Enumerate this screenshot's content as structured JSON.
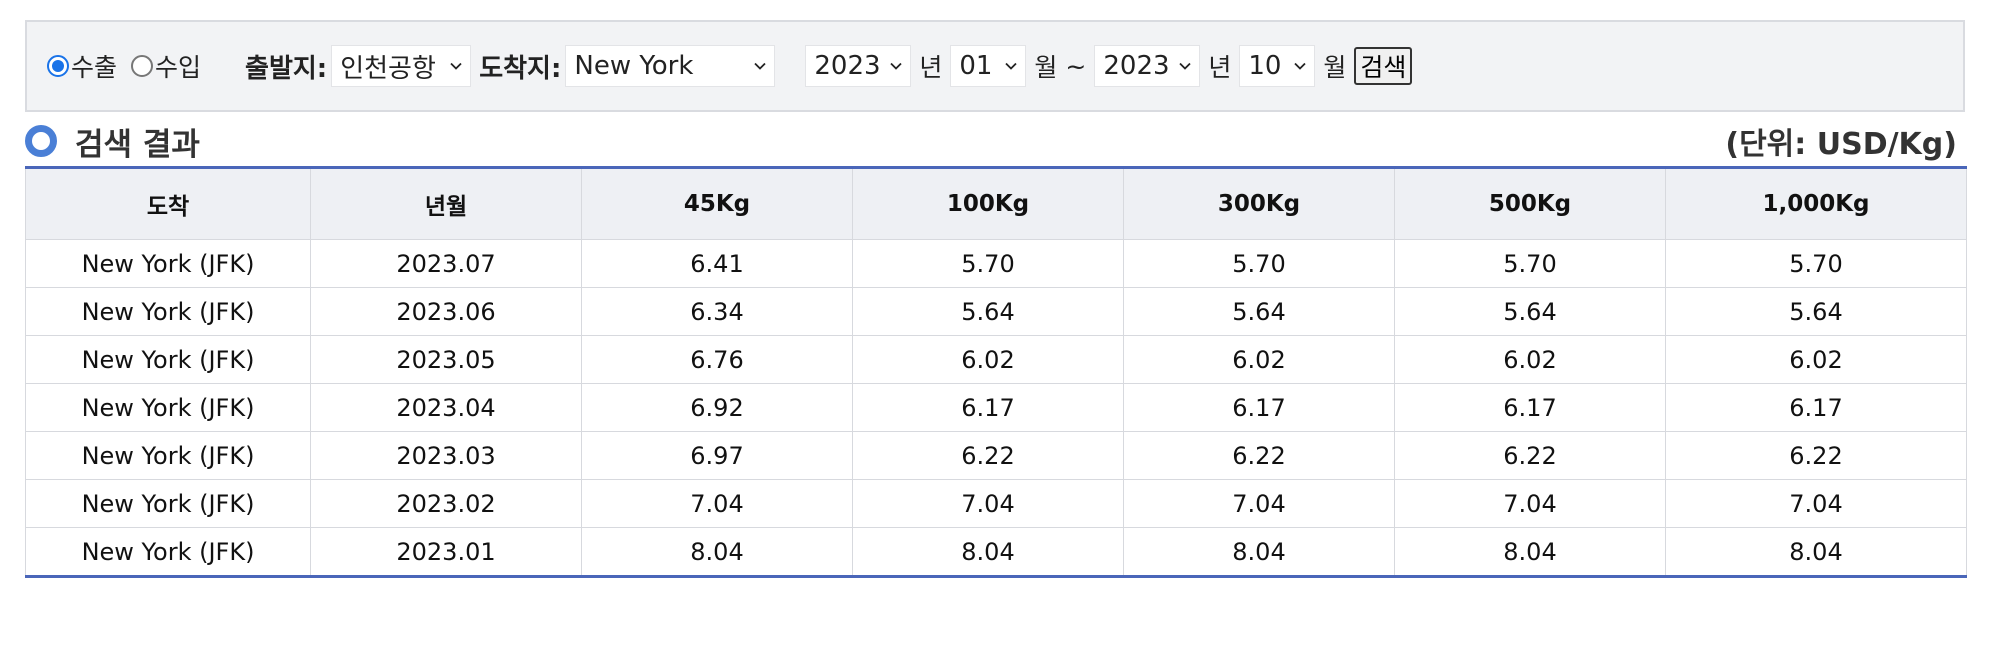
{
  "filters": {
    "radio_export": "수출",
    "radio_import": "수입",
    "selected_mode": "export",
    "origin_label": "출발지:",
    "origin_value": "인천공항",
    "dest_label": "도착지:",
    "dest_value": "New York",
    "start_year": "2023",
    "year_unit": "년",
    "start_month": "01",
    "month_unit": "월",
    "range_sep": "~",
    "end_year": "2023",
    "end_month": "10",
    "search_label": "검색"
  },
  "section": {
    "title": "검색 결과",
    "unit": "(단위: USD/Kg)"
  },
  "table": {
    "headers": [
      "도착",
      "년월",
      "45Kg",
      "100Kg",
      "300Kg",
      "500Kg",
      "1,000Kg"
    ],
    "rows": [
      [
        "New York (JFK)",
        "2023.07",
        "6.41",
        "5.70",
        "5.70",
        "5.70",
        "5.70"
      ],
      [
        "New York (JFK)",
        "2023.06",
        "6.34",
        "5.64",
        "5.64",
        "5.64",
        "5.64"
      ],
      [
        "New York (JFK)",
        "2023.05",
        "6.76",
        "6.02",
        "6.02",
        "6.02",
        "6.02"
      ],
      [
        "New York (JFK)",
        "2023.04",
        "6.92",
        "6.17",
        "6.17",
        "6.17",
        "6.17"
      ],
      [
        "New York (JFK)",
        "2023.03",
        "6.97",
        "6.22",
        "6.22",
        "6.22",
        "6.22"
      ],
      [
        "New York (JFK)",
        "2023.02",
        "7.04",
        "7.04",
        "7.04",
        "7.04",
        "7.04"
      ],
      [
        "New York (JFK)",
        "2023.01",
        "8.04",
        "8.04",
        "8.04",
        "8.04",
        "8.04"
      ]
    ]
  },
  "colors": {
    "accent": "#4a66b9",
    "radio_checked": "#1a73e8",
    "filter_bg": "#f2f3f5",
    "header_bg": "#eef0f4"
  }
}
